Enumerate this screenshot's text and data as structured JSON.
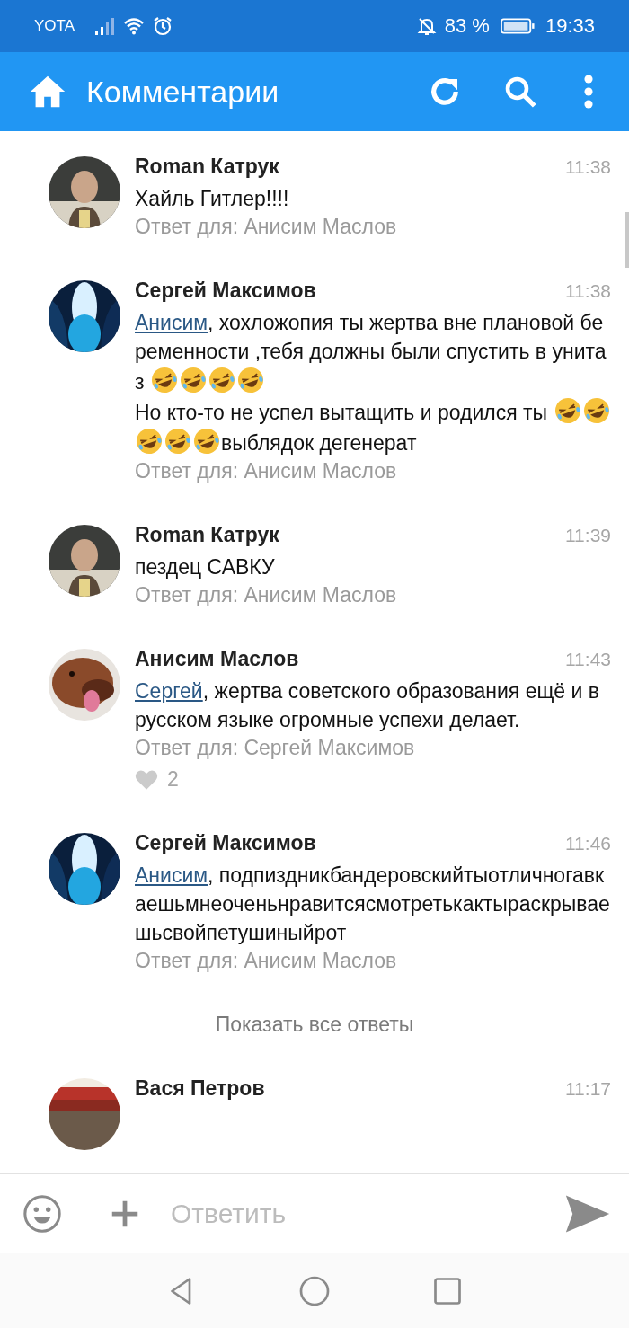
{
  "status_bar": {
    "carrier": "YOTA",
    "battery": "83 %",
    "time": "19:33"
  },
  "app_bar": {
    "title": "Комментарии"
  },
  "comments": [
    {
      "author": "Roman Катрук",
      "time": "11:38",
      "body": [
        {
          "kind": "text",
          "text": "Хайль Гитлер!!!!"
        }
      ],
      "reply_to": "Ответ для: Анисим Маслов"
    },
    {
      "author": "Сергей Максимов",
      "time": "11:38",
      "body": [
        {
          "kind": "mention",
          "text": "Анисим"
        },
        {
          "kind": "text",
          "text": ", хохложопия ты жертва вне плановой беременности ,тебя должны были спустить в унитаз "
        },
        {
          "kind": "emoji"
        },
        {
          "kind": "emoji"
        },
        {
          "kind": "emoji"
        },
        {
          "kind": "emoji"
        },
        {
          "kind": "text",
          "text": "\nНо кто-то не успел вытащить и родился ты "
        },
        {
          "kind": "emoji"
        },
        {
          "kind": "emoji"
        },
        {
          "kind": "emoji"
        },
        {
          "kind": "emoji"
        },
        {
          "kind": "emoji"
        },
        {
          "kind": "text",
          "text": "выблядок дегенерат"
        }
      ],
      "reply_to": "Ответ для: Анисим Маслов"
    },
    {
      "author": "Roman Катрук",
      "time": "11:39",
      "body": [
        {
          "kind": "text",
          "text": "пездец САВКУ"
        }
      ],
      "reply_to": "Ответ для: Анисим Маслов"
    },
    {
      "author": "Анисим Маслов",
      "time": "11:43",
      "body": [
        {
          "kind": "mention",
          "text": "Сергей"
        },
        {
          "kind": "text",
          "text": ", жертва советского образования ещё и в русском языке огромные успехи делает."
        }
      ],
      "reply_to": "Ответ для: Сергей Максимов",
      "likes": "2"
    },
    {
      "author": "Сергей Максимов",
      "time": "11:46",
      "body": [
        {
          "kind": "mention",
          "text": "Анисим"
        },
        {
          "kind": "text",
          "text": ", подпиздникбандеровскийтыотличногавкаешьмнеоченьнравитсясмотретькактыраскрываешьсвойпетушиныйрот"
        }
      ],
      "reply_to": "Ответ для: Анисим Маслов"
    }
  ],
  "show_all": "Показать все ответы",
  "next_comment": {
    "author": "Вася Петров",
    "time": "11:17"
  },
  "composer": {
    "placeholder": "Ответить"
  }
}
